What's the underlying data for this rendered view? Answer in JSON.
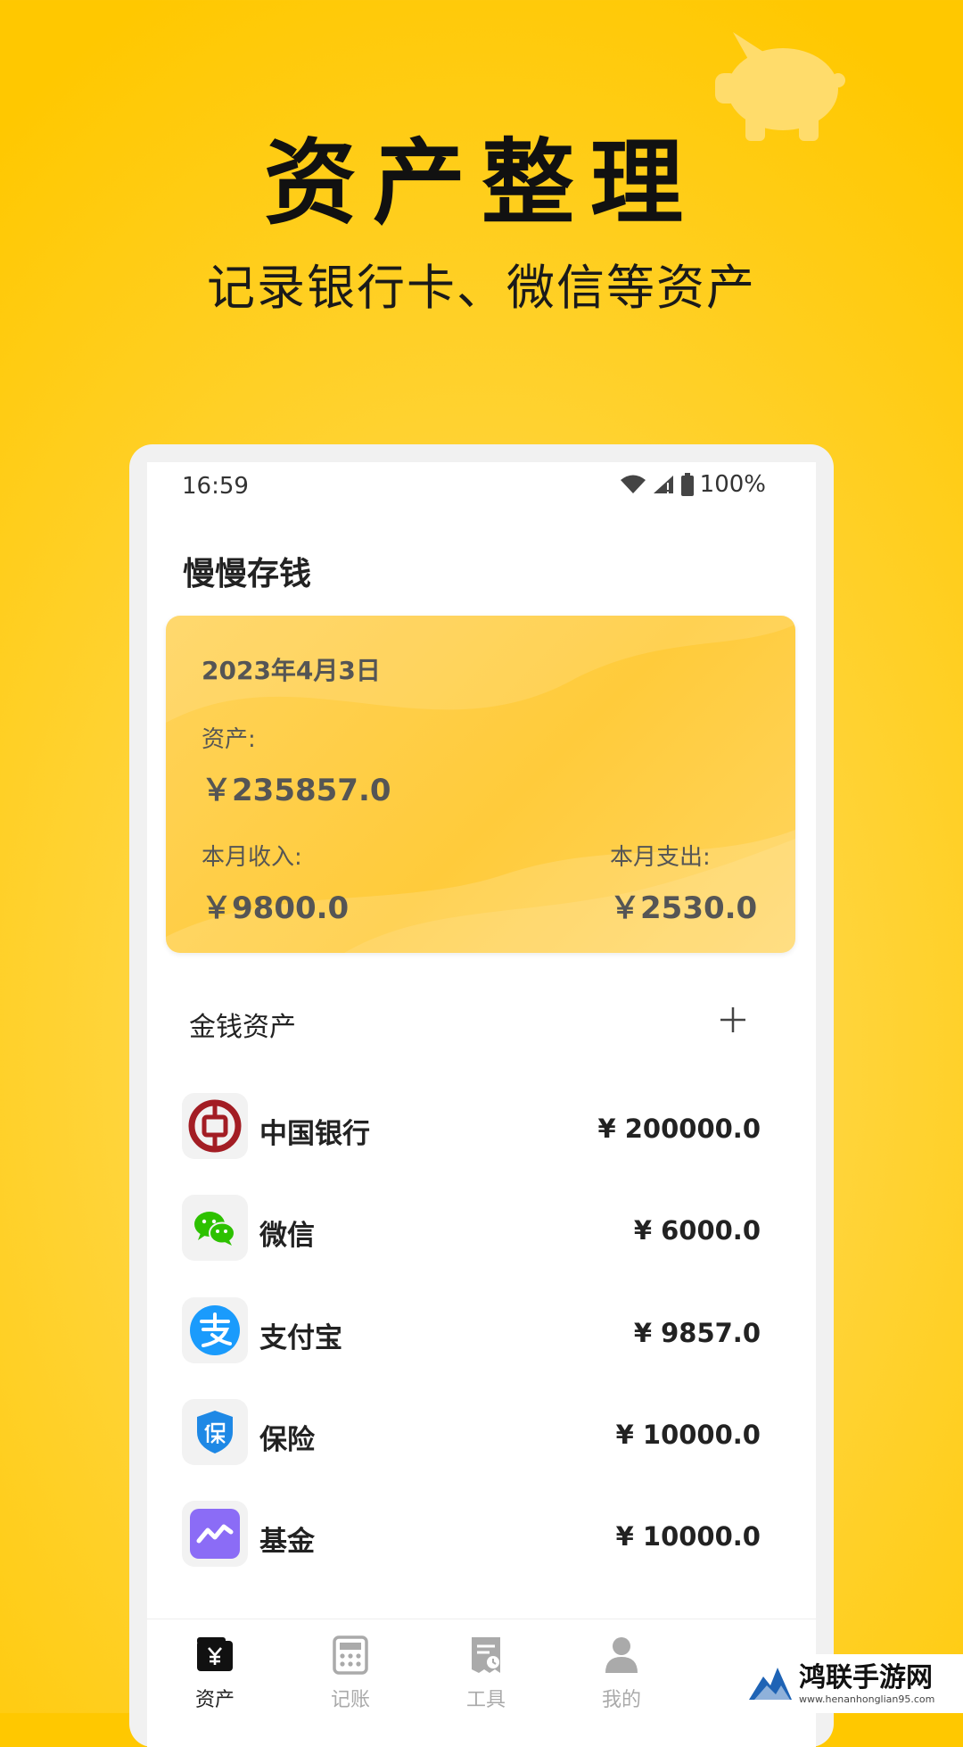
{
  "promo": {
    "headline": "资产整理",
    "subline": "记录银行卡、微信等资产"
  },
  "status_bar": {
    "time": "16:59",
    "battery": "100%"
  },
  "app": {
    "title": "慢慢存钱"
  },
  "summary_card": {
    "date": "2023年4月3日",
    "asset_label": "资产:",
    "asset_value": "￥235857.0",
    "income_label": "本月收入:",
    "income_value": "￥9800.0",
    "expense_label": "本月支出:",
    "expense_value": "￥2530.0"
  },
  "assets_section": {
    "title": "金钱资产",
    "add_icon": "plus-icon",
    "items": [
      {
        "name": "中国银行",
        "amount": "¥  200000.0",
        "icon": "bank-of-china-icon"
      },
      {
        "name": "微信",
        "amount": "¥  6000.0",
        "icon": "wechat-icon"
      },
      {
        "name": "支付宝",
        "amount": "¥  9857.0",
        "icon": "alipay-icon"
      },
      {
        "name": "保险",
        "amount": "¥  10000.0",
        "icon": "insurance-shield-icon"
      },
      {
        "name": "基金",
        "amount": "¥  10000.0",
        "icon": "fund-chart-icon"
      }
    ]
  },
  "tabs": [
    {
      "label": "资产",
      "icon": "wallet-yen-icon",
      "active": true
    },
    {
      "label": "记账",
      "icon": "calculator-icon",
      "active": false
    },
    {
      "label": "工具",
      "icon": "receipt-icon",
      "active": false
    },
    {
      "label": "我的",
      "icon": "person-icon",
      "active": false
    }
  ],
  "watermark": {
    "title": "鸿联手游网",
    "url": "www.henanhonglian95.com"
  },
  "colors": {
    "background": "#ffc800",
    "card": "#ffcb3b",
    "wechat": "#2dc100",
    "alipay": "#1a9bfc",
    "insurance": "#1e88e5",
    "fund": "#8b6cf6",
    "bank_of_china": "#a31d24"
  }
}
